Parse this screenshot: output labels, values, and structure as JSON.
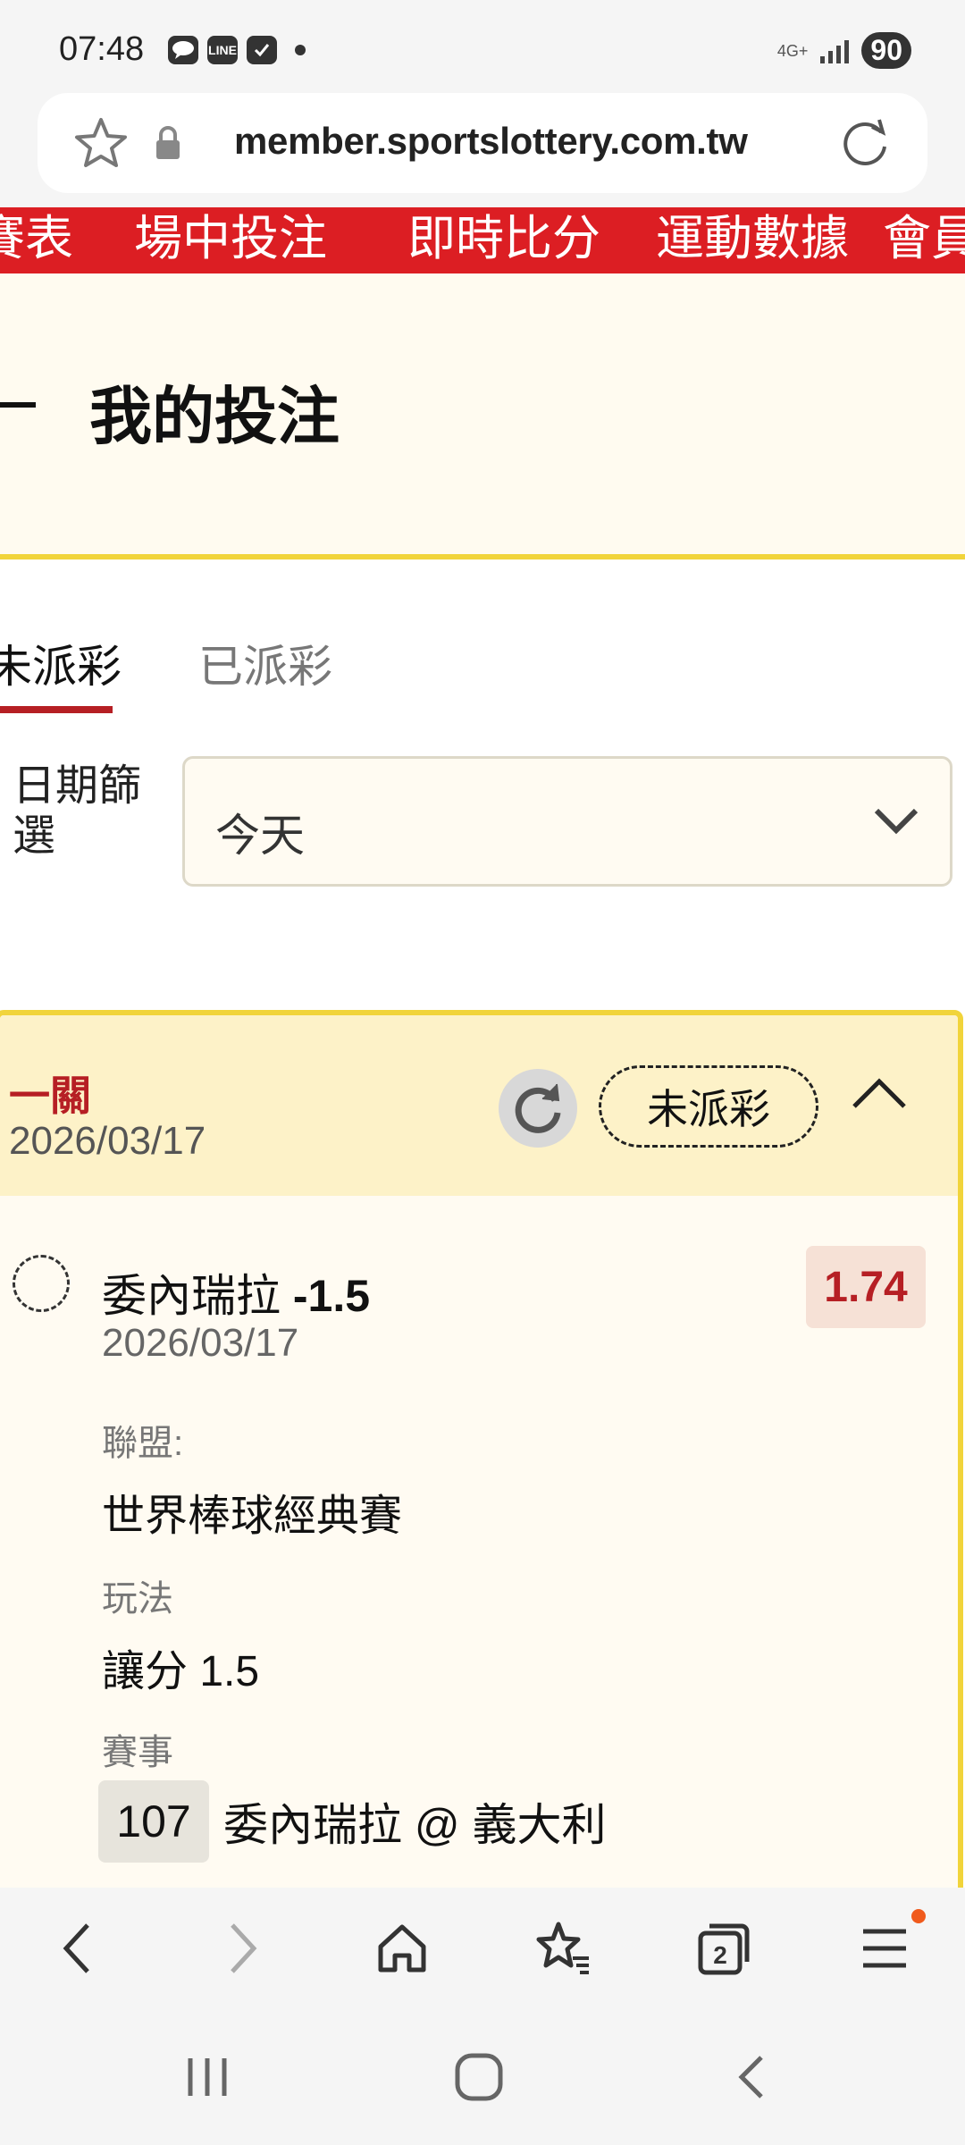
{
  "status_bar": {
    "time": "07:48",
    "left_icons": [
      "chat-icon",
      "line-icon",
      "checkbox-icon"
    ],
    "network": "4G+",
    "battery": "90"
  },
  "browser": {
    "url": "member.sportslottery.com.tw",
    "tab_count": "2"
  },
  "nav": {
    "items": [
      "賽表",
      "場中投注",
      "即時比分",
      "運動數據",
      "會員"
    ]
  },
  "page": {
    "title": "我的投注"
  },
  "tabs": [
    {
      "label": "未派彩",
      "active": true
    },
    {
      "label": "已派彩",
      "active": false
    }
  ],
  "filter": {
    "label": "日期篩選",
    "selected": "今天"
  },
  "bet": {
    "type": "一關",
    "date": "2026/03/17",
    "status": "未派彩",
    "selection_team": "委內瑞拉",
    "selection_handicap": "-1.5",
    "odds": "1.74",
    "selection_date": "2026/03/17",
    "league_label": "聯盟:",
    "league": "世界棒球經典賽",
    "market_label": "玩法",
    "market": "讓分 1.5",
    "event_label": "賽事",
    "event_no": "107",
    "event_name": "委內瑞拉 @ 義大利"
  },
  "colors": {
    "brand_red": "#dc1e23",
    "accent_yellow": "#f1d43b",
    "odds_red": "#b61f24"
  }
}
